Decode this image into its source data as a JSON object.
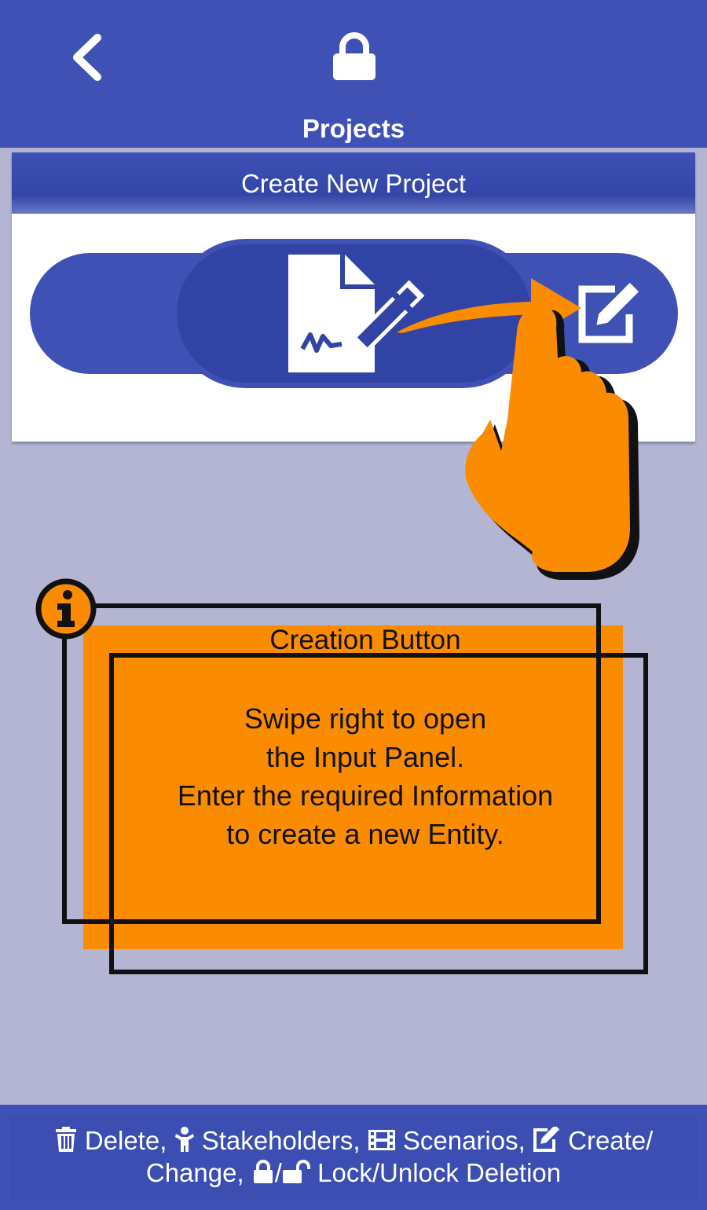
{
  "header": {
    "title": "Projects",
    "back_icon": "chevron-left-icon",
    "lock_icon": "lock-icon"
  },
  "card": {
    "header_label": "Create New Project",
    "doc_icon": "file-signature-icon",
    "edit_icon": "edit-icon"
  },
  "tip": {
    "title": "Creation Button",
    "body": "Swipe right to open\nthe Input Panel.\nEnter the required Information\nto create a new Entity.",
    "info_icon": "info-circle-icon",
    "hand_icon": "hand-swipe-icon"
  },
  "legend": {
    "delete": "Delete,",
    "stakeholders": "Stakeholders,",
    "scenarios": "Scenarios,",
    "create": "Create/",
    "change": "Change,",
    "slash": "/",
    "lock_unlock": "Lock/Unlock Deletion"
  },
  "colors": {
    "primary": "#3f51b5",
    "accent": "#fb8c00",
    "background": "#b3b5d2"
  }
}
